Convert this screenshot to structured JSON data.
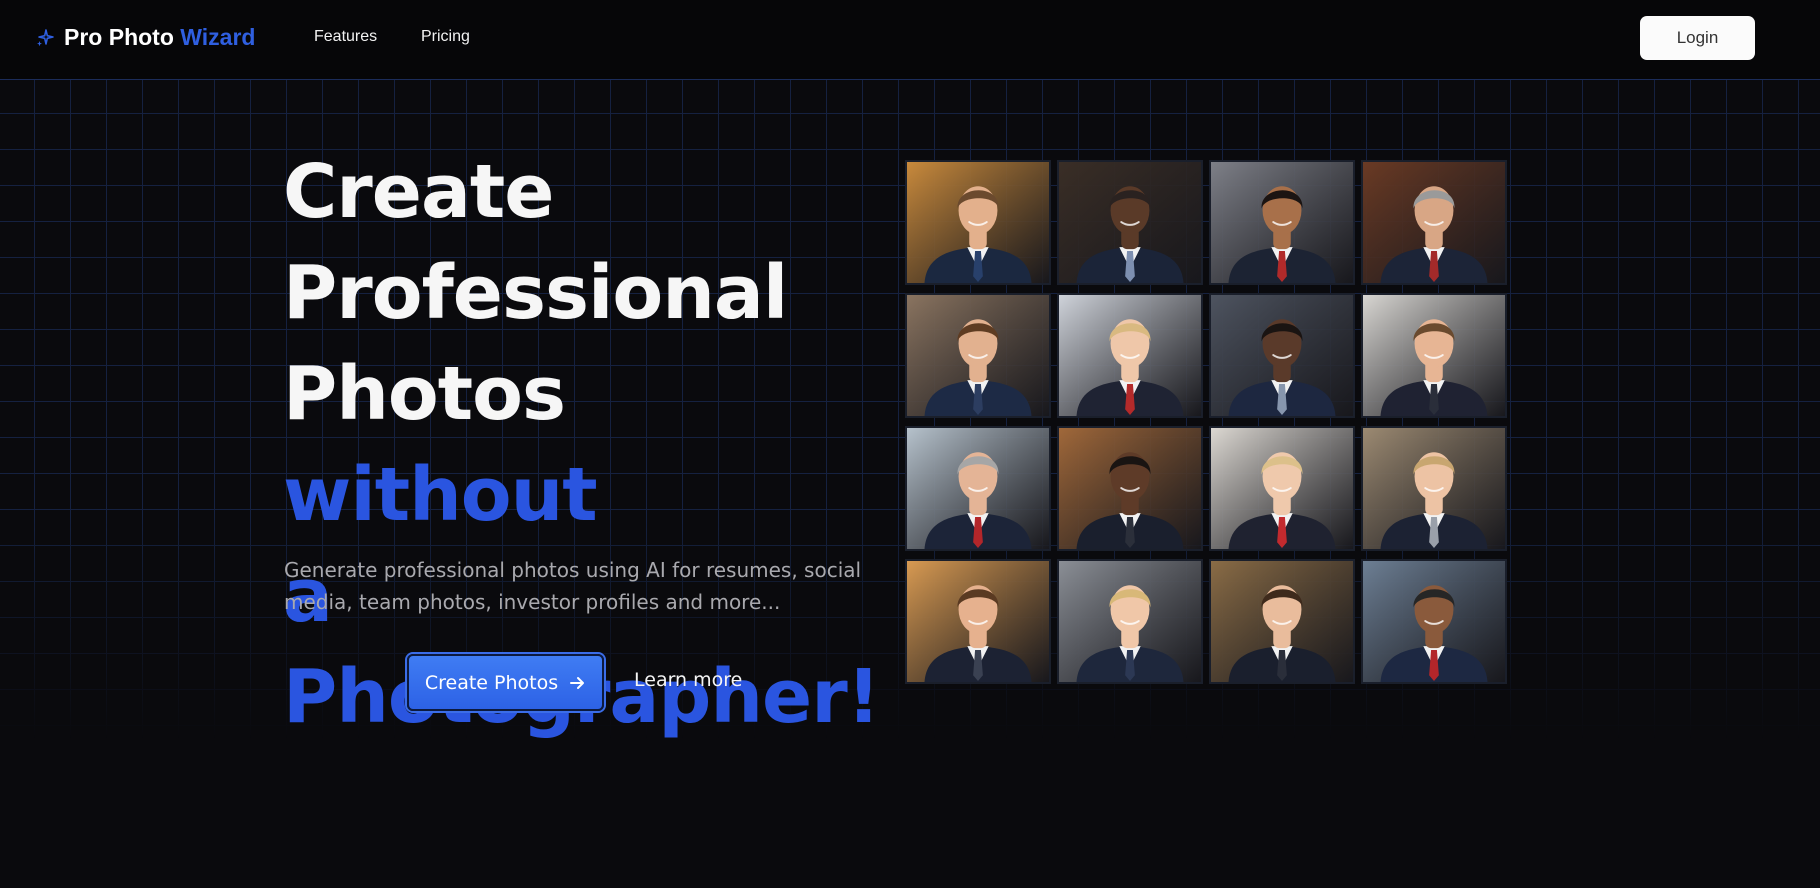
{
  "header": {
    "brand_main": "Pro Photo",
    "brand_accent": "Wizard",
    "nav": [
      "Features",
      "Pricing"
    ],
    "login_label": "Login"
  },
  "hero": {
    "title_line1": "Create",
    "title_line2": "Professional",
    "title_line3_a": "Photos",
    "title_line3_b": "without",
    "title_line4": "a Photographer!",
    "subtitle": "Generate professional photos using AI for resumes, social media, team photos, investor profiles and more...",
    "cta_primary": "Create Photos",
    "cta_secondary": "Learn more"
  },
  "colors": {
    "accent": "#2a55e0",
    "button": "#3a70ee",
    "background": "#0a0a0d",
    "grid_line": "#17264a"
  },
  "icons": {
    "brand": "sparkle-icon",
    "cta": "arrow-right-icon"
  },
  "photos": [
    {
      "bg": "#c98a3c",
      "skin": "#e3b08c",
      "hair": "#6b4a2e",
      "suit": "#1b2840",
      "tie": "#28406b"
    },
    {
      "bg": "#3a2e26",
      "skin": "#5a3a28",
      "hair": "#2a2220",
      "suit": "#1b2438",
      "tie": "#7d8fb0"
    },
    {
      "bg": "#7e8088",
      "skin": "#a8704a",
      "hair": "#1b1412",
      "suit": "#1c2333",
      "tie": "#b12a2a"
    },
    {
      "bg": "#6a3a24",
      "skin": "#d8a685",
      "hair": "#9a9a9a",
      "suit": "#1c2437",
      "tie": "#a32a2a"
    },
    {
      "bg": "#8a7460",
      "skin": "#e2b18f",
      "hair": "#5e3c22",
      "suit": "#1d2a45",
      "tie": "#2c3d60"
    },
    {
      "bg": "#cfd3da",
      "skin": "#efc7a9",
      "hair": "#d9b980",
      "suit": "#1f2333",
      "tie": "#b42a2a"
    },
    {
      "bg": "#4e5460",
      "skin": "#5a3a2a",
      "hair": "#1a1412",
      "suit": "#1d2740",
      "tie": "#8796ad"
    },
    {
      "bg": "#d8d6d2",
      "skin": "#e7b594",
      "hair": "#6a4a2e",
      "suit": "#1f2232",
      "tie": "#2a2e3a"
    },
    {
      "bg": "#b6c2cc",
      "skin": "#e4b496",
      "hair": "#a6a6a6",
      "suit": "#1c2438",
      "tie": "#b3262a"
    },
    {
      "bg": "#a0683a",
      "skin": "#5e3b28",
      "hair": "#191412",
      "suit": "#1a1f2d",
      "tie": "#2b2f3a"
    },
    {
      "bg": "#dcd8d2",
      "skin": "#efc9ac",
      "hair": "#dcc08a",
      "suit": "#1f2230",
      "tie": "#c22a2e"
    },
    {
      "bg": "#9c8a72",
      "skin": "#edc3a4",
      "hair": "#c8a670",
      "suit": "#1c2233",
      "tie": "#9aa0aa"
    },
    {
      "bg": "#d89a52",
      "skin": "#e6b18e",
      "hair": "#5a3a22",
      "suit": "#1c2233",
      "tie": "#3a4152"
    },
    {
      "bg": "#8b8f96",
      "skin": "#f0c7a8",
      "hair": "#d8b878",
      "suit": "#1e273c",
      "tie": "#2c3854"
    },
    {
      "bg": "#8a6c46",
      "skin": "#e9bc9c",
      "hair": "#3e2a1c",
      "suit": "#1a1f2d",
      "tie": "#2a2e3a"
    },
    {
      "bg": "#6d7f94",
      "skin": "#8a5a3c",
      "hair": "#262626",
      "suit": "#1d2842",
      "tie": "#b3262a"
    }
  ]
}
